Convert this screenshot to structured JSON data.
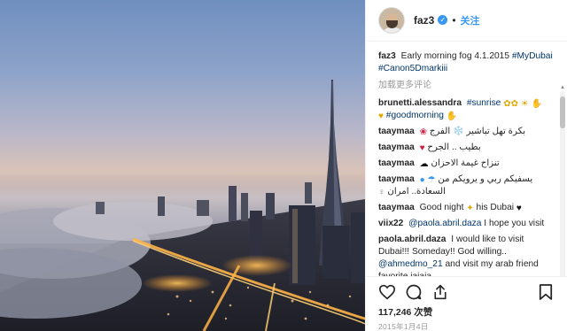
{
  "header": {
    "username": "faz3",
    "separator": "•",
    "follow_label": "关注"
  },
  "caption": {
    "username": "faz3",
    "text": "Early morning fog 4.1.2015",
    "hashtag1": "#MyDubai",
    "hashtag2": "#Canon5Dmarkiii"
  },
  "load_more_label": "加载更多评论",
  "comments": [
    {
      "user": "brunetti.alessandra",
      "text": "#sunrise",
      "tag2": "#goodmorning"
    },
    {
      "user": "taaymaa",
      "text": "بكرة تهل تباشير ❄️ الفرج"
    },
    {
      "user": "taaymaa",
      "text": "بطيب .. الجرح"
    },
    {
      "user": "taaymaa",
      "text": "تنزاح غيمة الاحزان"
    },
    {
      "user": "taaymaa",
      "text": "يسفيكم ربي و يرويكم من",
      "text2": "السعادة.. امران"
    },
    {
      "user": "taaymaa",
      "text": "Good night",
      "text2": "his Dubai"
    },
    {
      "user": "viix22",
      "text": "@paola.abril.daza",
      "text2": "I hope you visit"
    },
    {
      "user": "paola.abril.daza",
      "text": "I would like to visit Dubai!!! Someday!! God willing..",
      "mention": "@ahmedmo_21",
      "text2": "and visit my arab friend favorite jajaja"
    }
  ],
  "likes_label": "117,246 次赞",
  "date_label": "2015年1月4日",
  "icons": {
    "like": "heart-icon",
    "comment": "comment-icon",
    "share": "share-icon",
    "save": "bookmark-icon"
  }
}
